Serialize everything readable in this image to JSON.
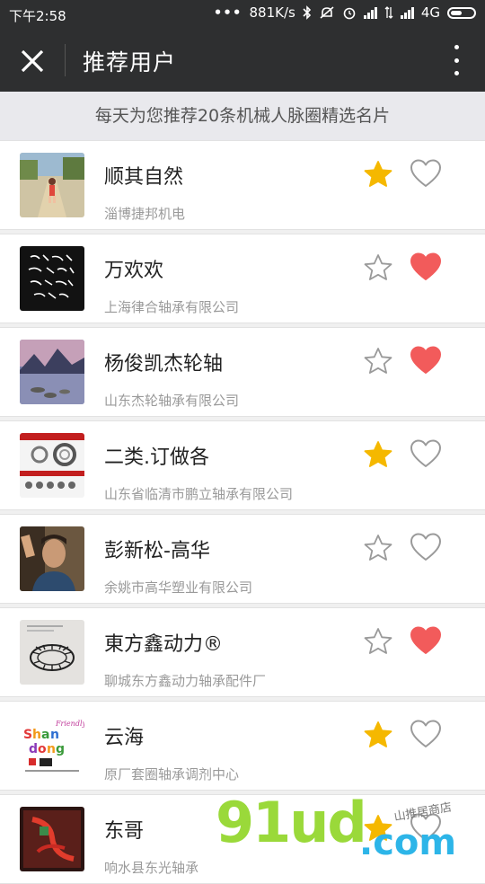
{
  "status_bar": {
    "time": "下午2:58",
    "dots": "•••",
    "speed": "881K/s",
    "network": "4G"
  },
  "header": {
    "title": "推荐用户"
  },
  "banner": {
    "text": "每天为您推荐20条机械人脉圈精选名片"
  },
  "colors": {
    "header_bg": "#2e2f30",
    "star_active": "#f5b800",
    "heart_active": "#f25b5b",
    "outline_gray": "#9a9a9a"
  },
  "users": [
    {
      "name": "顺其自然",
      "company": "淄博捷邦机电",
      "starred": true,
      "liked": false,
      "avatar": "photo-child-on-road"
    },
    {
      "name": "万欢欢",
      "company": "上海律合轴承有限公司",
      "starred": false,
      "liked": true,
      "avatar": "calligraphy-black"
    },
    {
      "name": "杨俊凯杰轮轴",
      "company": "山东杰轮轴承有限公司",
      "starred": false,
      "liked": true,
      "avatar": "mountain-lake"
    },
    {
      "name": "二类.订做各",
      "company": "山东省临清市鹏立轴承有限公司",
      "starred": true,
      "liked": false,
      "avatar": "bearing-poster"
    },
    {
      "name": "彭新松-高华",
      "company": "余姚市高华塑业有限公司",
      "starred": false,
      "liked": false,
      "avatar": "man-portrait"
    },
    {
      "name": "東方鑫动力®",
      "company": "聊城东方鑫动力轴承配件厂",
      "starred": false,
      "liked": true,
      "avatar": "bearing-cage-sketch"
    },
    {
      "name": "云海",
      "company": "原厂套圈轴承调剂中心",
      "starred": true,
      "liked": false,
      "avatar": "shandong-logo"
    },
    {
      "name": "东哥",
      "company": "响水县东光轴承",
      "starred": true,
      "liked": false,
      "avatar": "red-art"
    }
  ],
  "watermark": {
    "main": "91ud",
    "com": ".com",
    "cn": "山推居商店"
  }
}
